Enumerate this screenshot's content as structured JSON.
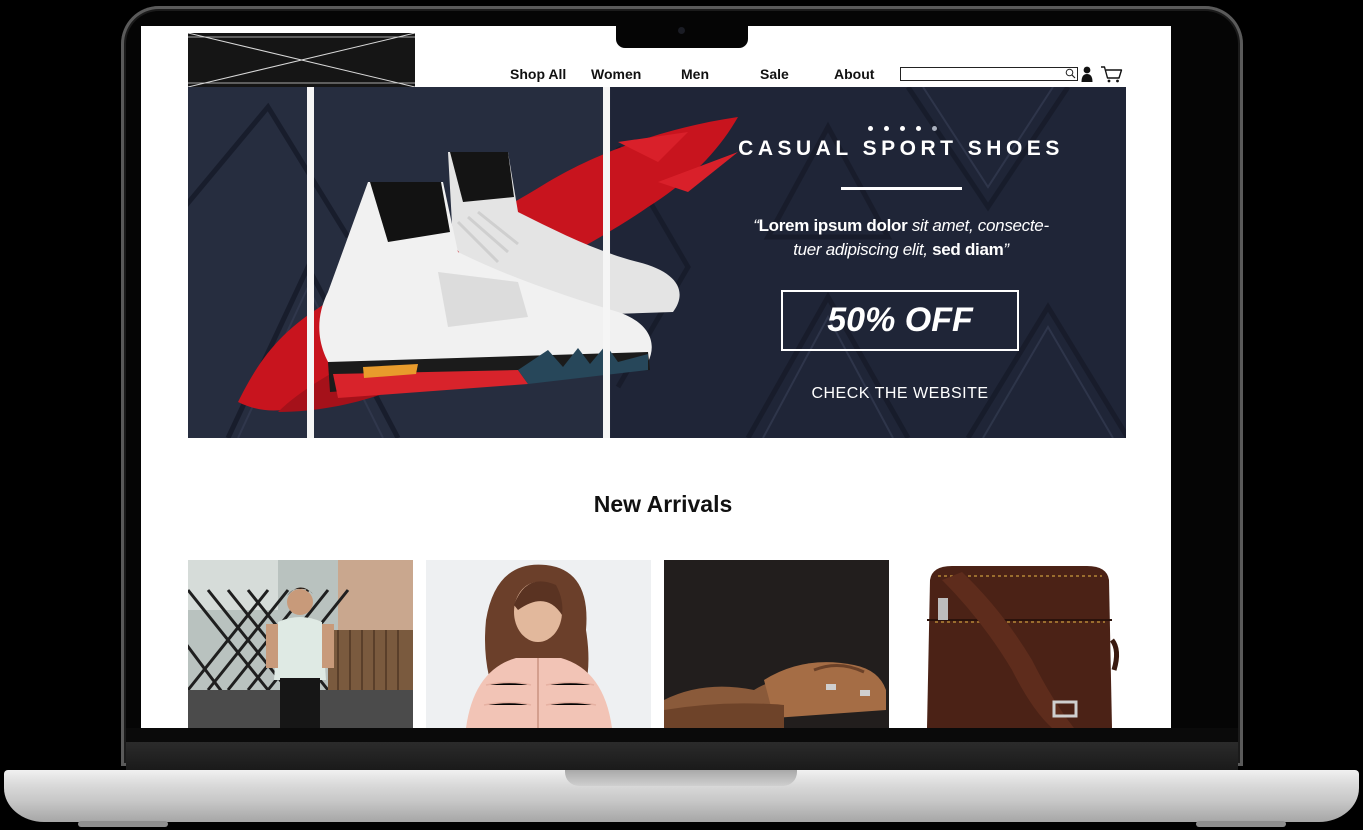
{
  "nav": {
    "items": [
      "Shop All",
      "Women",
      "Men",
      "Sale",
      "About"
    ]
  },
  "search": {
    "value": "",
    "placeholder": ""
  },
  "icons": {
    "search": "search-icon",
    "account": "user-icon",
    "cart": "cart-icon",
    "logo": "image-placeholder-icon"
  },
  "hero": {
    "title": "CASUAL SPORT SHOES",
    "quote_bold_1": "Lorem ipsum dolor",
    "quote_regular_1": " sit amet, consecte-",
    "quote_regular_2": "tuer adipiscing elit, ",
    "quote_bold_2": "sed diam",
    "cta": "50% OFF",
    "link": "CHECK THE WEBSITE",
    "slides_total": 5,
    "active_slide": 1
  },
  "arrivals": {
    "title": "New Arrivals",
    "products": [
      "man-tshirt-photo",
      "woman-jacket-photo",
      "brown-shoes-photo",
      "leather-bag-photo"
    ]
  },
  "colors": {
    "hero_bg": "#22283a",
    "accent_red": "#c8141e",
    "text": "#111111"
  }
}
